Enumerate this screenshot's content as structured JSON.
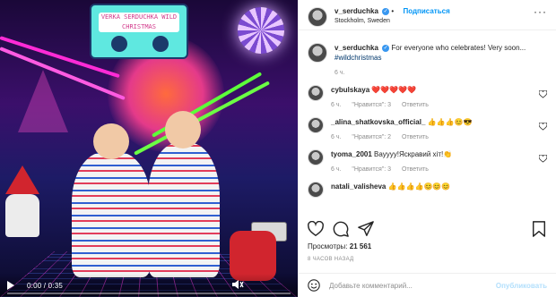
{
  "video": {
    "time": "0:00 / 0:35",
    "progress": 0.0,
    "tape_text": "VERKA SERDUCHKA WILD CHRISTMAS"
  },
  "header": {
    "username": "v_serduchka",
    "follow_label": "Подписаться",
    "location": "Stockholm, Sweden",
    "more_icon": "more-icon"
  },
  "caption": {
    "username": "v_serduchka",
    "text": "For everyone who celebrates! Very soon...",
    "hashtag": "#wildchristmas",
    "time": "6 ч."
  },
  "comments": [
    {
      "username": "cybulskaya",
      "text": "❤️❤️❤️❤️❤️",
      "time": "6 ч.",
      "likes": "\"Нравится\": 3",
      "reply": "Ответить"
    },
    {
      "username": "_alina_shatkovska_official_",
      "text": "👍👍👍😊😎",
      "time": "6 ч.",
      "likes": "\"Нравится\": 2",
      "reply": "Ответить"
    },
    {
      "username": "tyoma_2001",
      "text": "Вауууу!Яскравий хіт!👏",
      "time": "6 ч.",
      "likes": "\"Нравится\": 3",
      "reply": "Ответить"
    },
    {
      "username": "natali_valisheva",
      "text": "👍👍👍👍😊😊😊",
      "time": "",
      "likes": "",
      "reply": ""
    }
  ],
  "stats": {
    "views_label": "Просмотры:",
    "views_value": "21 561",
    "posted_ago": "8 ЧАСОВ НАЗАД"
  },
  "compose": {
    "placeholder": "Добавьте комментарий...",
    "publish_label": "Опубликовать"
  },
  "colors": {
    "accent": "#0095f6",
    "verified": "#3897f0",
    "muted": "#8e8e8e",
    "publish_disabled": "#b2dffc"
  }
}
